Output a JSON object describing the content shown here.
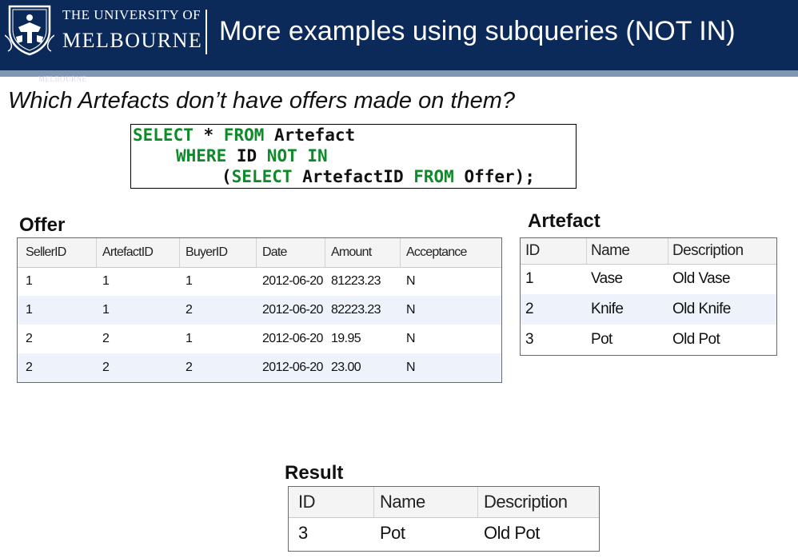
{
  "header": {
    "university_line1": "THE UNIVERSITY OF",
    "university_line2": "MELBOURNE",
    "slide_title": "More examples using subqueries (NOT IN)",
    "ghost_text": "MELBOURNE"
  },
  "question": "Which Artefacts don’t have offers made on them?",
  "sql": {
    "line1_kw1": "SELECT",
    "line1_rest1": " * ",
    "line1_kw2": "FROM",
    "line1_rest2": " Artefact",
    "line2_kw1": "WHERE",
    "line2_rest1": " ID ",
    "line2_kw2": "NOT IN",
    "line3_open": "(",
    "line3_kw1": "SELECT",
    "line3_rest1": " ArtefactID ",
    "line3_kw2": "FROM",
    "line3_rest2": " Offer);"
  },
  "offer": {
    "caption": "Offer",
    "headers": [
      "SellerID",
      "ArtefactID",
      "BuyerID",
      "Date",
      "Amount",
      "Acceptance"
    ],
    "rows": [
      [
        "1",
        "1",
        "1",
        "2012-06-20",
        "81223.23",
        "N"
      ],
      [
        "1",
        "1",
        "2",
        "2012-06-20",
        "82223.23",
        "N"
      ],
      [
        "2",
        "2",
        "1",
        "2012-06-20",
        "19.95",
        "N"
      ],
      [
        "2",
        "2",
        "2",
        "2012-06-20",
        "23.00",
        "N"
      ]
    ]
  },
  "artefact": {
    "caption": "Artefact",
    "headers": [
      "ID",
      "Name",
      "Description"
    ],
    "rows": [
      [
        "1",
        "Vase",
        "Old Vase"
      ],
      [
        "2",
        "Knife",
        "Old Knife"
      ],
      [
        "3",
        "Pot",
        "Old Pot"
      ]
    ]
  },
  "result": {
    "caption": "Result",
    "headers": [
      "ID",
      "Name",
      "Description"
    ],
    "rows": [
      [
        "3",
        "Pot",
        "Old Pot"
      ]
    ]
  },
  "colors": {
    "header_bg": "#0b2a5a",
    "header_stripe": "#7e97b2",
    "sql_keyword": "#0f8a2a",
    "row_alt": "#eef3fb"
  }
}
